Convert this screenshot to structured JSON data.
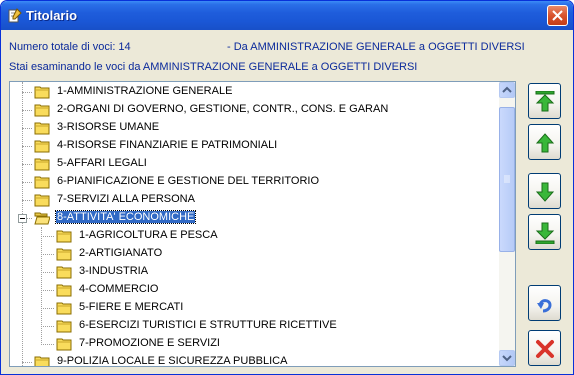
{
  "window": {
    "title": "Titolario"
  },
  "info": {
    "total_label": "Numero totale di voci: 14",
    "range_label": "- Da AMMINISTRAZIONE GENERALE a OGGETTI DIVERSI",
    "examining_label": "Stai esaminando le voci da AMMINISTRAZIONE GENERALE a OGGETTI DIVERSI"
  },
  "tree": {
    "items": [
      {
        "label": "1-AMMINISTRAZIONE GENERALE",
        "level": 0
      },
      {
        "label": "2-ORGANI DI GOVERNO, GESTIONE, CONTR., CONS. E GARAN",
        "level": 0
      },
      {
        "label": "3-RISORSE UMANE",
        "level": 0
      },
      {
        "label": "4-RISORSE FINANZIARIE E PATRIMONIALI",
        "level": 0
      },
      {
        "label": "5-AFFARI LEGALI",
        "level": 0
      },
      {
        "label": "6-PIANIFICAZIONE E GESTIONE DEL TERRITORIO",
        "level": 0
      },
      {
        "label": "7-SERVIZI ALLA PERSONA",
        "level": 0
      },
      {
        "label": "8-ATTIVITA' ECONOMICHE",
        "level": 0,
        "expanded": true,
        "selected": true
      },
      {
        "label": "1-AGRICOLTURA E PESCA",
        "level": 1
      },
      {
        "label": "2-ARTIGIANATO",
        "level": 1
      },
      {
        "label": "3-INDUSTRIA",
        "level": 1
      },
      {
        "label": "4-COMMERCIO",
        "level": 1
      },
      {
        "label": "5-FIERE E MERCATI",
        "level": 1
      },
      {
        "label": "6-ESERCIZI TURISTICI E STRUTTURE RICETTIVE",
        "level": 1
      },
      {
        "label": "7-PROMOZIONE E SERVIZI",
        "level": 1
      },
      {
        "label": "9-POLIZIA LOCALE E SICUREZZA PUBBLICA",
        "level": 0
      }
    ]
  },
  "toolbar": {
    "buttons": [
      {
        "icon": "move-to-top-icon"
      },
      {
        "icon": "move-up-icon"
      },
      {
        "icon": "move-down-icon"
      },
      {
        "icon": "move-to-bottom-icon"
      },
      {
        "icon": "undo-icon"
      },
      {
        "icon": "delete-icon"
      }
    ]
  },
  "colors": {
    "info_text": "#0b2a9b",
    "selection": "#316ac5",
    "arrow_green": "#2ea52e",
    "delete_red": "#d9342b"
  }
}
